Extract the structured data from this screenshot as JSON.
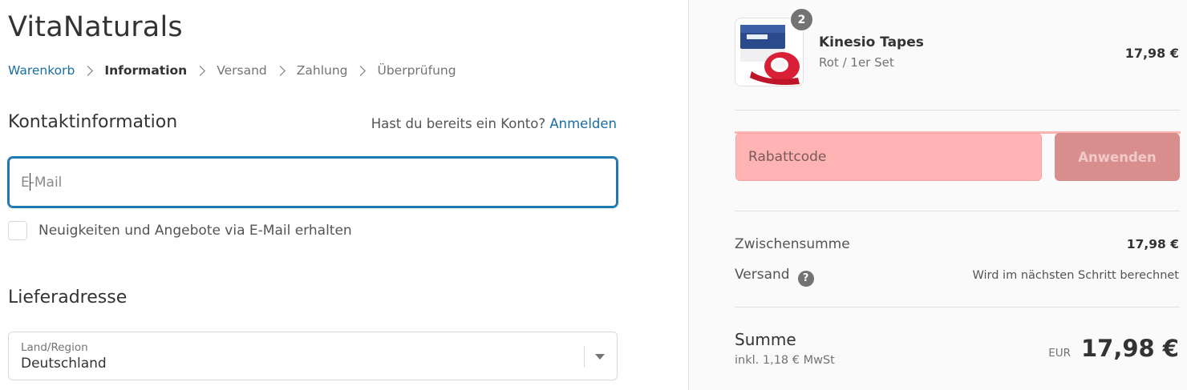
{
  "brand": {
    "name": "VitaNaturals"
  },
  "breadcrumb": {
    "items": [
      {
        "label": "Warenkorb"
      },
      {
        "label": "Information"
      },
      {
        "label": "Versand"
      },
      {
        "label": "Zahlung"
      },
      {
        "label": "Überprüfung"
      }
    ]
  },
  "contact": {
    "title": "Kontaktinformation",
    "login_prompt": "Hast du bereits ein Konto?",
    "login_link": "Anmelden",
    "email_placeholder": "E-Mail",
    "newsletter_label": "Neuigkeiten und Angebote via E-Mail erhalten",
    "newsletter_checked": false
  },
  "shipping_address": {
    "title": "Lieferadresse",
    "country_label": "Land/Region",
    "country_value": "Deutschland"
  },
  "order_summary": {
    "product": {
      "name": "Kinesio Tapes",
      "variant": "Rot / 1er Set",
      "price": "17,98 €",
      "quantity": "2"
    },
    "discount": {
      "placeholder": "Rabattcode",
      "button_label": "Anwenden"
    },
    "subtotal": {
      "label": "Zwischensumme",
      "value": "17,98 €"
    },
    "shipping": {
      "label": "Versand",
      "value": "Wird im nächsten Schritt berechnet",
      "help_icon": "question-circle-icon"
    },
    "total": {
      "label": "Summe",
      "tax_note": "inkl. 1,18 € MwSt",
      "currency": "EUR",
      "amount": "17,98 €"
    }
  },
  "colors": {
    "link": "#1a6ea0",
    "focus_border": "#1f78b0",
    "discount_highlight": "#ffb3b3",
    "apply_button": "#d98e8e"
  }
}
